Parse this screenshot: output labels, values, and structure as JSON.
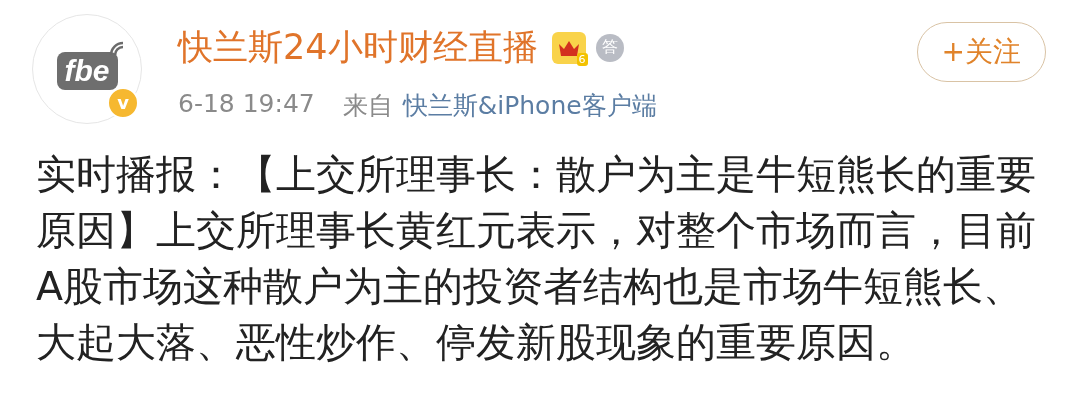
{
  "post": {
    "avatar": {
      "logo_text": "fbe",
      "verified_mark": "v"
    },
    "author": {
      "name": "快兰斯24小时财经直播",
      "badges": [
        {
          "kind": "crown",
          "text": "6"
        },
        {
          "kind": "medal",
          "text": "答"
        }
      ]
    },
    "time": "6-18 19:47",
    "source_prefix": "来自",
    "source": "快兰斯&iPhone客户端",
    "follow_button": "+关注",
    "body": "实时播报：【上交所理事长：散户为主是牛短熊长的重要原因】上交所理事长黄红元表示，对整个市场而言，目前A股市场这种散户为主的投资者结构也是市场牛短熊长、大起大落、恶性炒作、停发新股现象的重要原因。"
  }
}
